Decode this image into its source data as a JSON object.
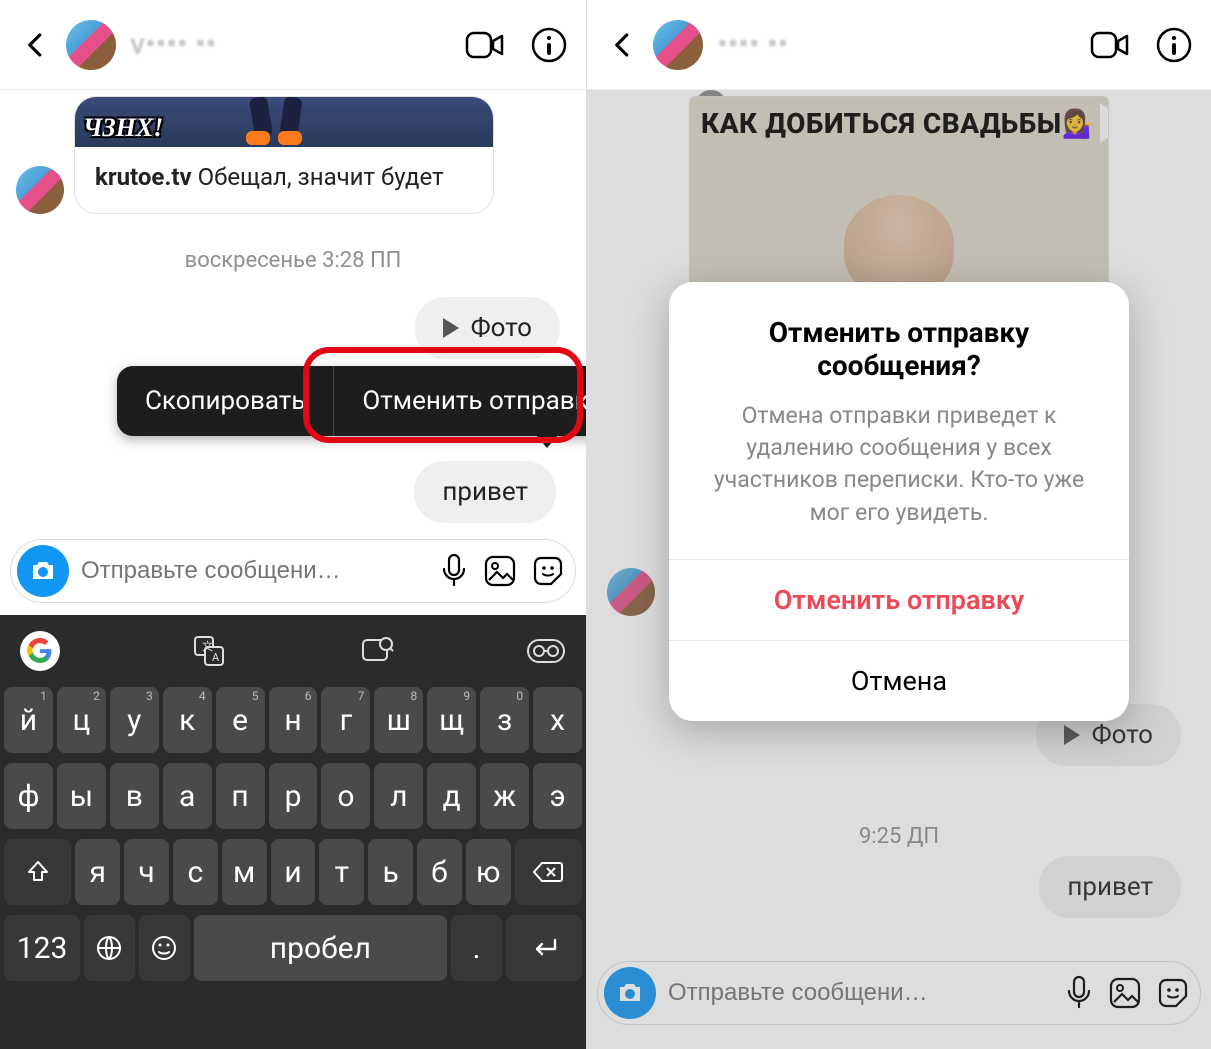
{
  "left": {
    "header": {
      "username_masked": "v••••  ••"
    },
    "shared": {
      "badge": "ЧЗНХ!",
      "author": "krutoe.tv",
      "caption": "Обещал, значит будет"
    },
    "timestamp": "воскресенье 3:28 ПП",
    "bubble_photo": "Фото",
    "bubble_hi": "привет",
    "context_menu": {
      "copy": "Скопировать",
      "unsend": "Отменить отправку"
    },
    "composer_placeholder": "Отправьте сообщени…",
    "keyboard": {
      "row1": [
        {
          "k": "й",
          "h": "1"
        },
        {
          "k": "ц",
          "h": "2"
        },
        {
          "k": "у",
          "h": "3"
        },
        {
          "k": "к",
          "h": "4"
        },
        {
          "k": "е",
          "h": "5"
        },
        {
          "k": "н",
          "h": "6"
        },
        {
          "k": "г",
          "h": "7"
        },
        {
          "k": "ш",
          "h": "8"
        },
        {
          "k": "щ",
          "h": "9"
        },
        {
          "k": "з",
          "h": "0"
        },
        {
          "k": "х",
          "h": ""
        }
      ],
      "row2": [
        {
          "k": "ф"
        },
        {
          "k": "ы"
        },
        {
          "k": "в"
        },
        {
          "k": "а"
        },
        {
          "k": "п"
        },
        {
          "k": "р"
        },
        {
          "k": "о"
        },
        {
          "k": "л"
        },
        {
          "k": "д"
        },
        {
          "k": "ж"
        },
        {
          "k": "э"
        }
      ],
      "row3": [
        {
          "k": "я"
        },
        {
          "k": "ч"
        },
        {
          "k": "с"
        },
        {
          "k": "м"
        },
        {
          "k": "и"
        },
        {
          "k": "т"
        },
        {
          "k": "ь"
        },
        {
          "k": "б"
        },
        {
          "k": "ю"
        }
      ],
      "num_key": "123",
      "space": "пробел",
      "enter": "↵"
    }
  },
  "right": {
    "header": {
      "username_masked": "••••  ••"
    },
    "story_title": "КАК ДОБИТЬСЯ СВАДЬБЫ",
    "story_emoji": "💁‍♀️",
    "modal": {
      "title": "Отменить отправку сообщения?",
      "body": "Отмена отправки приведет к удалению сообщения у всех участников переписки. Кто-то уже мог его увидеть.",
      "confirm": "Отменить отправку",
      "cancel": "Отмена"
    },
    "bubble_photo": "Фото",
    "timestamp": "9:25 ДП",
    "bubble_hi": "привет",
    "composer_placeholder": "Отправьте сообщени…"
  },
  "colors": {
    "highlight": "#e30613",
    "danger": "#ed4956",
    "primary_blue": "#1296f3"
  }
}
